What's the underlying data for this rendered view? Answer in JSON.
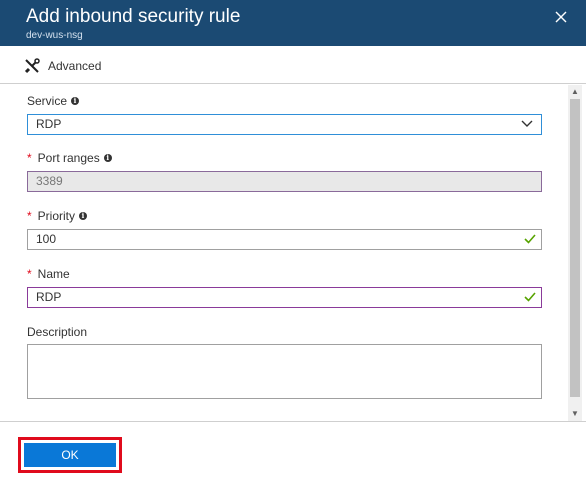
{
  "header": {
    "title": "Add inbound security rule",
    "subtitle": "dev-wus-nsg",
    "close_icon": "close-icon"
  },
  "toolbar": {
    "advanced_label": "Advanced",
    "advanced_icon": "tools-icon"
  },
  "form": {
    "service": {
      "label": "Service",
      "value": "RDP",
      "required": false
    },
    "port_ranges": {
      "label": "Port ranges",
      "value": "3389",
      "required": true,
      "disabled": true
    },
    "priority": {
      "label": "Priority",
      "value": "100",
      "required": true,
      "valid": true
    },
    "name": {
      "label": "Name",
      "value": "RDP",
      "required": true,
      "valid": true
    },
    "description": {
      "label": "Description",
      "value": ""
    }
  },
  "footer": {
    "ok_label": "OK"
  },
  "colors": {
    "header_bg": "#1b4a73",
    "primary_button": "#0a78d7",
    "required": "#e00b1c",
    "valid_check": "#57a300",
    "highlight_outline": "#e00b1c"
  }
}
